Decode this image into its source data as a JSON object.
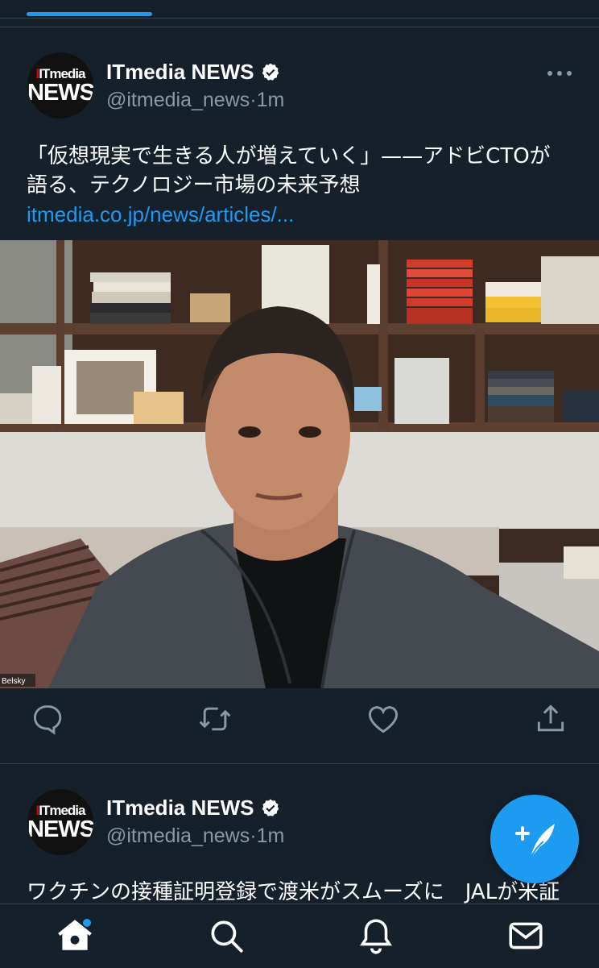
{
  "colors": {
    "background": "#15202b",
    "accent": "#1d9bf0",
    "secondary_text": "#8b98a5",
    "divider": "#38444d"
  },
  "tabs": {
    "active_index": 0
  },
  "tweets": [
    {
      "avatar": {
        "logo_top": "ITmedia",
        "logo_bottom": "NEWS"
      },
      "display_name": "ITmedia NEWS",
      "verified_icon": "verified-badge-icon",
      "handle": "@itmedia_news",
      "separator": "·",
      "time": "1m",
      "text_line1": "「仮想現実で生きる人が増えていく」——アドビCTOが",
      "text_line2": "語る、テクノロジー市場の未来予想",
      "link": "itmedia.co.jp/news/articles/...",
      "media_caption": "Belsky",
      "actions": [
        "reply-icon",
        "retweet-icon",
        "like-icon",
        "share-icon"
      ]
    },
    {
      "avatar": {
        "logo_top": "ITmedia",
        "logo_bottom": "NEWS"
      },
      "display_name": "ITmedia NEWS",
      "verified_icon": "verified-badge-icon",
      "handle": "@itmedia_news",
      "separator": "·",
      "time": "1m",
      "text_line1": "ワクチンの接種証明登録で渡米がスムーズに　JALが米証"
    }
  ],
  "fab": {
    "icon": "compose-tweet-icon"
  },
  "bottom_nav": [
    "home-icon",
    "search-icon",
    "notifications-icon",
    "messages-icon"
  ]
}
